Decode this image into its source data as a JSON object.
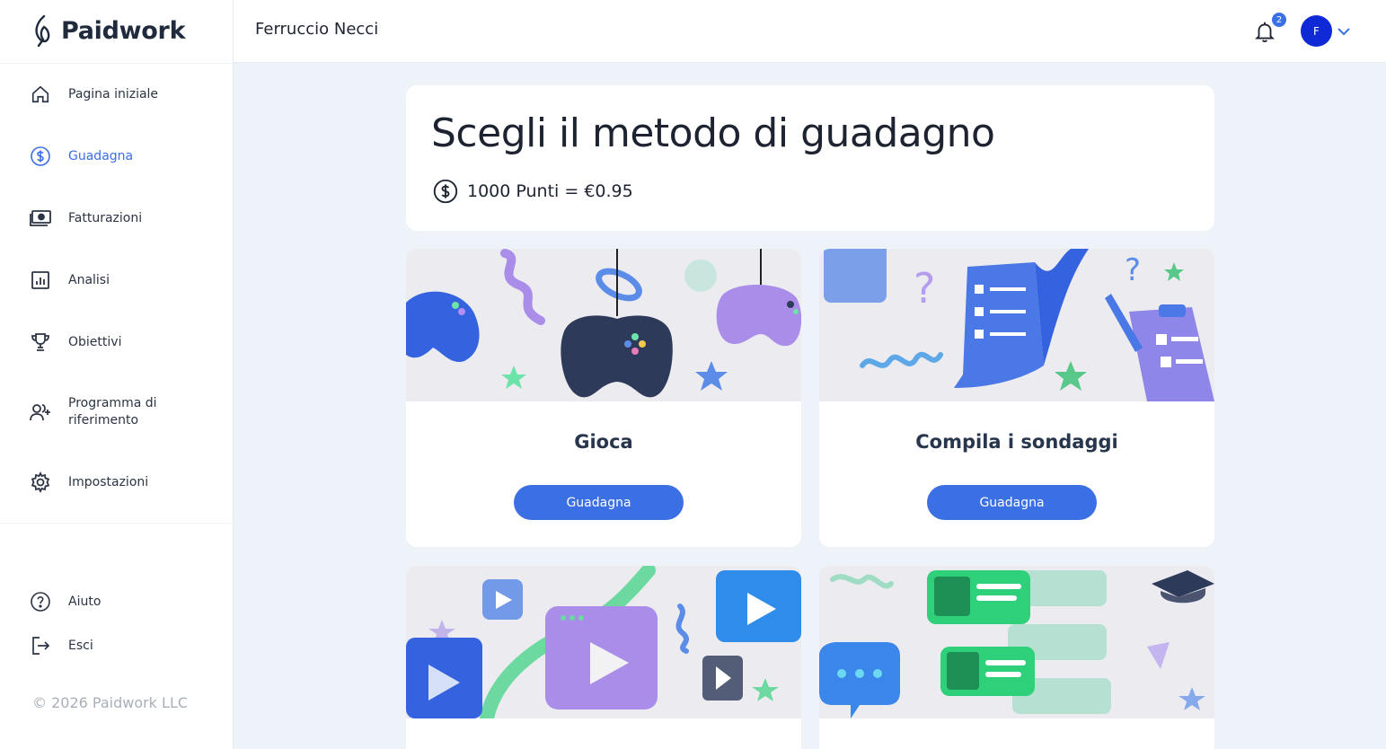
{
  "brand": {
    "name": "Paidwork"
  },
  "header": {
    "user_name": "Ferruccio Necci",
    "notification_count": "2",
    "avatar_initial": "F"
  },
  "sidebar": {
    "items": [
      {
        "label": "Pagina iniziale",
        "icon": "home-icon"
      },
      {
        "label": "Guadagna",
        "icon": "dollar-circle-icon",
        "active": true
      },
      {
        "label": "Fatturazioni",
        "icon": "money-icon"
      },
      {
        "label": "Analisi",
        "icon": "chart-icon"
      },
      {
        "label": "Obiettivi",
        "icon": "trophy-icon"
      },
      {
        "label": "Programma di riferimento",
        "icon": "add-users-icon"
      },
      {
        "label": "Impostazioni",
        "icon": "gear-icon"
      }
    ],
    "bottom": [
      {
        "label": "Aiuto",
        "icon": "help-icon"
      },
      {
        "label": "Esci",
        "icon": "logout-icon"
      }
    ],
    "copyright": "© 2026 Paidwork LLC"
  },
  "main": {
    "title": "Scegli il metodo di guadagno",
    "points_rate": "1000 Punti = €0.95",
    "cards": [
      {
        "title": "Gioca",
        "button": "Guadagna",
        "image": "game-controllers"
      },
      {
        "title": "Compila i sondaggi",
        "button": "Guadagna",
        "image": "surveys-checklist"
      },
      {
        "title": "",
        "button": "",
        "image": "video-play"
      },
      {
        "title": "",
        "button": "",
        "image": "tasks-cards"
      }
    ]
  },
  "colors": {
    "accent": "#3b6fe4",
    "avatar": "#1029d6",
    "background": "#eef3fa"
  }
}
